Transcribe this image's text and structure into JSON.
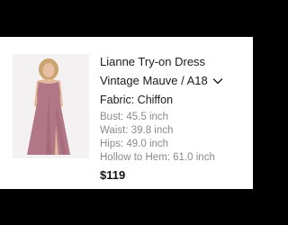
{
  "product": {
    "title": "Lianne Try-on Dress",
    "variant": "Vintage Mauve / A18",
    "fabric": "Fabric: Chiffon",
    "measurements": [
      "Bust: 45.5 inch",
      "Waist: 39.8 inch",
      "Hips: 49.0 inch",
      "Hollow to Hem: 61.0 inch"
    ],
    "price": "$119"
  },
  "icons": {
    "variant_dropdown": "chevron-down-icon"
  },
  "colors": {
    "dress": "#b27786",
    "muted_text": "#8a8a8a",
    "text": "#1a1a1a"
  }
}
